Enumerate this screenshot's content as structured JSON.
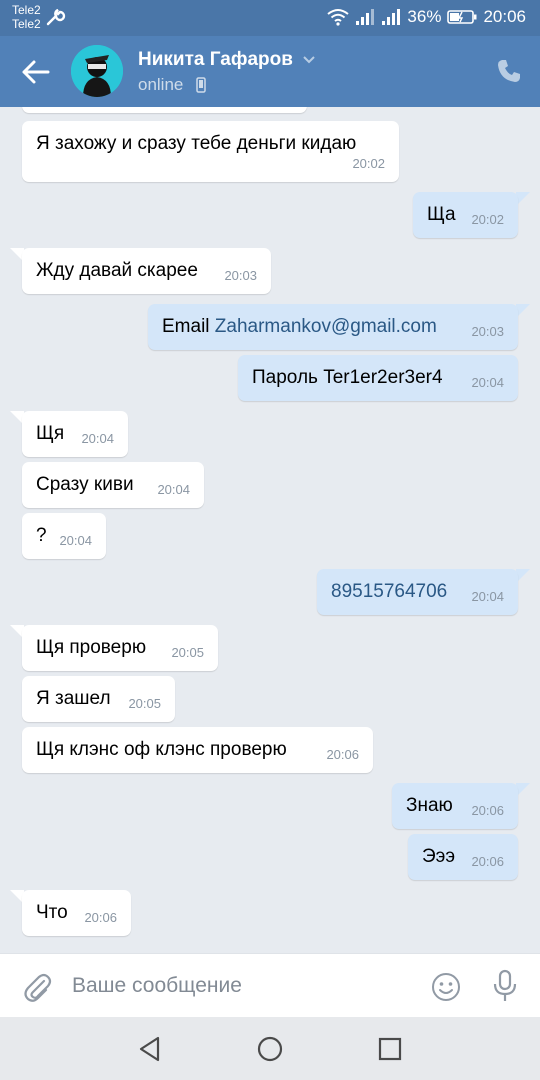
{
  "status_bar": {
    "carrier_1": "Tele2",
    "carrier_2": "Tele2",
    "battery": "36%",
    "time": "20:06"
  },
  "header": {
    "contact_name": "Никита Гафаров",
    "status": "online"
  },
  "messages": [
    {
      "dir": "in",
      "text": "Я захожу и сразу тебе деньги кидаю",
      "time": "20:02"
    },
    {
      "dir": "out",
      "text": "Ща",
      "time": "20:02"
    },
    {
      "dir": "in",
      "text": "Жду давай скарее",
      "time": "20:03"
    },
    {
      "dir": "out",
      "text_prefix": "Email ",
      "link": "Zaharmankov@gmail.com",
      "time": "20:03"
    },
    {
      "dir": "out",
      "text": "Пароль Ter1er2er3er4",
      "time": "20:04"
    },
    {
      "dir": "in",
      "text": "Щя",
      "time": "20:04"
    },
    {
      "dir": "in",
      "text": "Сразу киви",
      "time": "20:04"
    },
    {
      "dir": "in",
      "text": "?",
      "time": "20:04"
    },
    {
      "dir": "out",
      "link": "89515764706",
      "time": "20:04"
    },
    {
      "dir": "in",
      "text": "Щя проверю",
      "time": "20:05"
    },
    {
      "dir": "in",
      "text": "Я зашел",
      "time": "20:05"
    },
    {
      "dir": "in",
      "text": "Щя клэнс оф клэнс проверю",
      "time": "20:06"
    },
    {
      "dir": "out",
      "text": "Знаю",
      "time": "20:06"
    },
    {
      "dir": "out",
      "text": "Эээ",
      "time": "20:06"
    },
    {
      "dir": "in",
      "text": "Что",
      "time": "20:06"
    }
  ],
  "composer": {
    "placeholder": "Ваше сообщение"
  },
  "colors": {
    "status_bar": "#4a76a8",
    "app_bar": "#5181b8",
    "chat_bg": "#e7ebf0",
    "incoming_bubble": "#ffffff",
    "outgoing_bubble": "#d4e6f9",
    "link": "#2a5885"
  }
}
